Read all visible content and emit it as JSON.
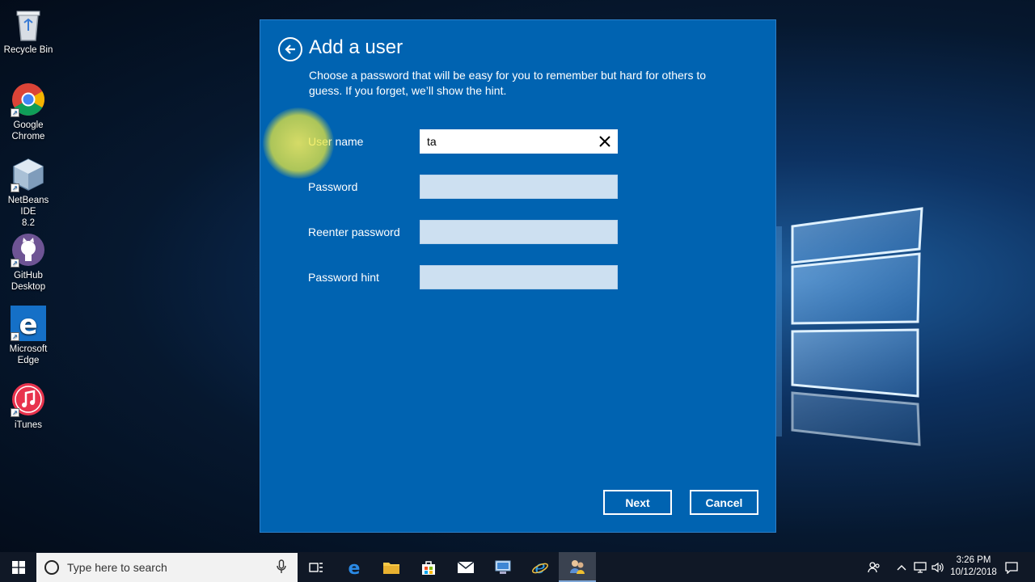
{
  "desktop": {
    "icons": [
      {
        "label_line1": "Recycle Bin",
        "label_line2": "",
        "icon": "recycle-bin-icon"
      },
      {
        "label_line1": "Google",
        "label_line2": "Chrome",
        "icon": "chrome-icon"
      },
      {
        "label_line1": "NetBeans IDE",
        "label_line2": "8.2",
        "icon": "netbeans-icon"
      },
      {
        "label_line1": "GitHub",
        "label_line2": "Desktop",
        "icon": "github-icon"
      },
      {
        "label_line1": "Microsoft",
        "label_line2": "Edge",
        "icon": "edge-icon"
      },
      {
        "label_line1": "iTunes",
        "label_line2": "",
        "icon": "itunes-icon"
      }
    ]
  },
  "dialog": {
    "title": "Add a user",
    "description": "Choose a password that will be easy for you to remember but hard for others to guess. If you forget, we’ll show the hint.",
    "fields": {
      "username": {
        "label": "User name",
        "value": "ta"
      },
      "password": {
        "label": "Password",
        "value": ""
      },
      "reenter": {
        "label": "Reenter password",
        "value": ""
      },
      "hint": {
        "label": "Password hint",
        "value": ""
      }
    },
    "buttons": {
      "next": "Next",
      "cancel": "Cancel"
    },
    "colors": {
      "background": "#0063b1",
      "field": "#cde0f1"
    }
  },
  "taskbar": {
    "search_placeholder": "Type here to search",
    "apps": [
      "task-view-icon",
      "edge-icon",
      "file-explorer-icon",
      "store-icon",
      "mail-icon",
      "network-connections-icon",
      "internet-explorer-icon",
      "user-accounts-icon"
    ],
    "clock": {
      "time": "3:26 PM",
      "date": "10/12/2018"
    }
  }
}
